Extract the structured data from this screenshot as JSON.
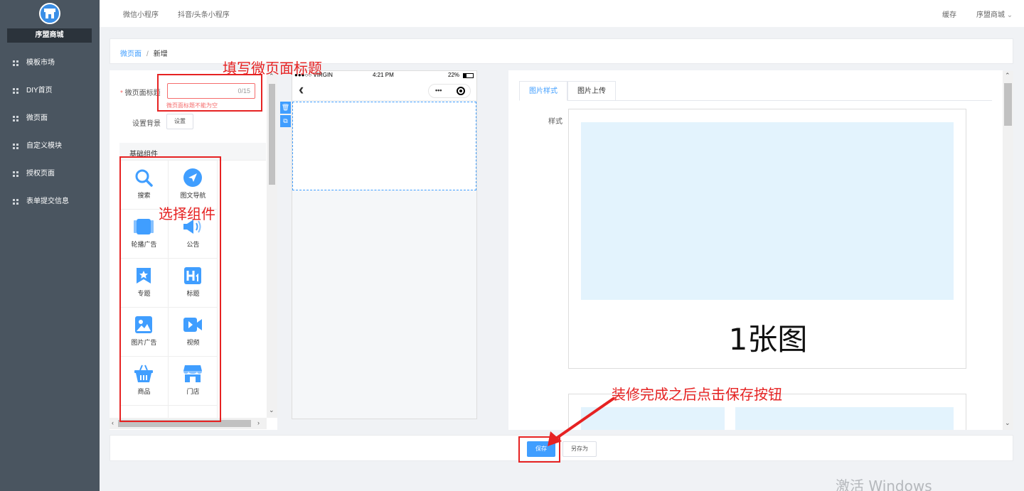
{
  "sidebar": {
    "shop_name": "序盟商城",
    "items": [
      {
        "label": "模板市场"
      },
      {
        "label": "DIY首页"
      },
      {
        "label": "微页面"
      },
      {
        "label": "自定义模块"
      },
      {
        "label": "授权页面"
      },
      {
        "label": "表单提交信息"
      }
    ]
  },
  "topbar": {
    "tabs": [
      {
        "label": "微信小程序"
      },
      {
        "label": "抖音/头条小程序"
      }
    ],
    "cache_label": "缓存",
    "user_label": "序盟商城"
  },
  "breadcrumb": {
    "parent": "微页面",
    "separator": "/",
    "current": "新增"
  },
  "form": {
    "title_label": "微页面标题",
    "title_counter": "0/15",
    "title_error": "微页面标题不能为空",
    "bg_label": "设置背景",
    "bg_button": "设置"
  },
  "components": {
    "header": "基础组件",
    "items": [
      {
        "label": "搜索",
        "icon": "search-icon"
      },
      {
        "label": "图文导航",
        "icon": "navigation-icon"
      },
      {
        "label": "轮播广告",
        "icon": "carousel-icon"
      },
      {
        "label": "公告",
        "icon": "announcement-icon"
      },
      {
        "label": "专题",
        "icon": "topic-icon"
      },
      {
        "label": "标题",
        "icon": "heading-icon"
      },
      {
        "label": "图片广告",
        "icon": "image-ad-icon"
      },
      {
        "label": "视频",
        "icon": "video-icon"
      },
      {
        "label": "商品",
        "icon": "product-icon"
      },
      {
        "label": "门店",
        "icon": "store-icon"
      }
    ]
  },
  "phone": {
    "carrier": "●●●○○ VIRGIN",
    "time": "4:21 PM",
    "battery": "22%",
    "back_glyph": "‹",
    "menu_glyph": "•••",
    "side_delete_glyph": "🗑",
    "side_copy_glyph": "⧉"
  },
  "right_panel": {
    "tabs": [
      {
        "label": "图片样式",
        "active": true
      },
      {
        "label": "图片上传",
        "active": false
      }
    ],
    "style_label": "样式",
    "preview_text": "1张图"
  },
  "footer": {
    "save_label": "保存",
    "save_as_label": "另存为"
  },
  "annotations": {
    "fill_title": "填写微页面标题",
    "choose_component": "选择组件",
    "save_hint": "装修完成之后点击保存按钮"
  },
  "watermark": "激活 Windows",
  "colors": {
    "accent": "#409eff",
    "sidebar": "#4a5560",
    "annotation": "#e62222",
    "error": "#f56c6c"
  }
}
